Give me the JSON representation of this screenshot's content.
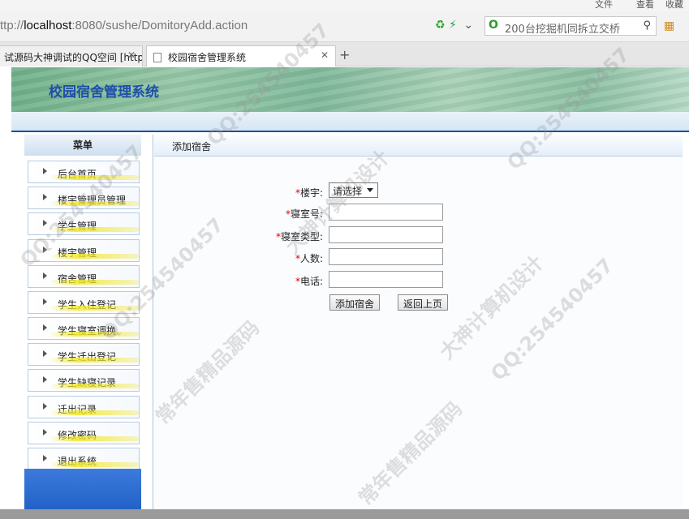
{
  "browser": {
    "top_menu": {
      "file": "文件",
      "view": "查看",
      "bookmarks": "收藏"
    },
    "url_prefix": "ttp://",
    "url_host": "localhost",
    "url_rest": ":8080/sushe/DomitoryAdd.action",
    "search_text": "200台挖掘机同拆立交桥",
    "tabs": [
      {
        "label": "试源码大神调试的QQ空间 [http:"
      },
      {
        "label": "校园宿舍管理系统",
        "active": true
      }
    ]
  },
  "header": {
    "site_title": "校园宿舍管理系统"
  },
  "sidebar": {
    "title": "菜单",
    "items": [
      {
        "label": "后台首页"
      },
      {
        "label": "楼宇管理员管理"
      },
      {
        "label": "学生管理"
      },
      {
        "label": "楼宇管理"
      },
      {
        "label": "宿舍管理"
      },
      {
        "label": "学生入住登记"
      },
      {
        "label": "学生寝室调换"
      },
      {
        "label": "学生迁出登记"
      },
      {
        "label": "学生缺寝记录"
      },
      {
        "label": "迁出记录"
      },
      {
        "label": "修改密码"
      },
      {
        "label": "退出系统"
      }
    ]
  },
  "content": {
    "title": "添加宿舍",
    "required_mark": "*",
    "fields": [
      {
        "label": "楼宇:",
        "type": "select",
        "value": "请选择"
      },
      {
        "label": "寝室号:",
        "type": "text",
        "value": ""
      },
      {
        "label": "寝室类型:",
        "type": "text",
        "value": ""
      },
      {
        "label": "人数:",
        "type": "text",
        "value": ""
      },
      {
        "label": "电话:",
        "type": "text",
        "value": ""
      }
    ],
    "submit_label": "添加宿舍",
    "back_label": "返回上页"
  },
  "watermarks": [
    "QQ:254540457",
    "大神计算机设计",
    "常年售精品源码",
    "QQ:254540457",
    "QQ:254540457",
    "大神计算机设计",
    "QQ:254540457",
    "常年售精品源码",
    "QQ:254540457"
  ]
}
